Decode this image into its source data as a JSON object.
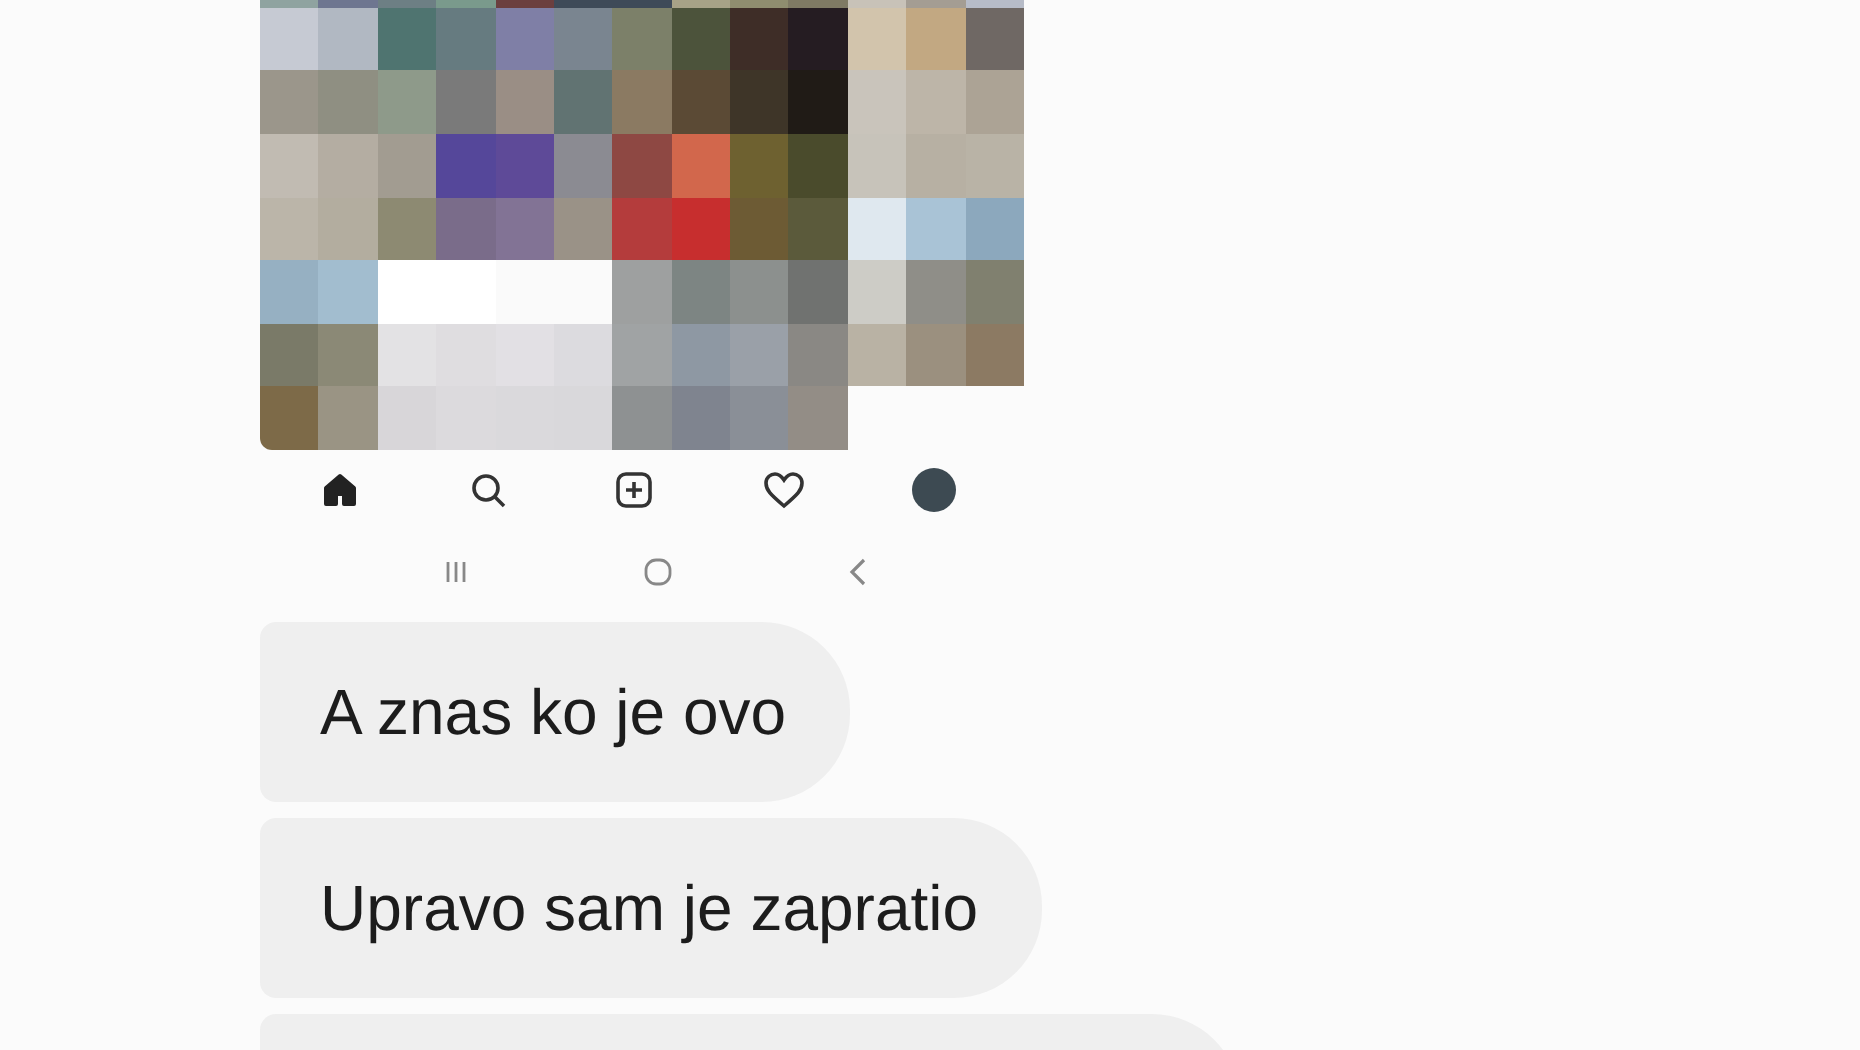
{
  "post_nav": [
    {
      "kind": "home",
      "selected": true
    },
    {
      "kind": "search",
      "selected": false
    },
    {
      "kind": "add",
      "selected": false
    },
    {
      "kind": "heart",
      "selected": false
    },
    {
      "kind": "profile",
      "selected": false
    }
  ],
  "system_nav": [
    {
      "kind": "recents"
    },
    {
      "kind": "home"
    },
    {
      "kind": "back"
    }
  ],
  "messages": [
    {
      "text": "A znas ko je ovo"
    },
    {
      "text": "Upravo sam je zapratio"
    }
  ]
}
